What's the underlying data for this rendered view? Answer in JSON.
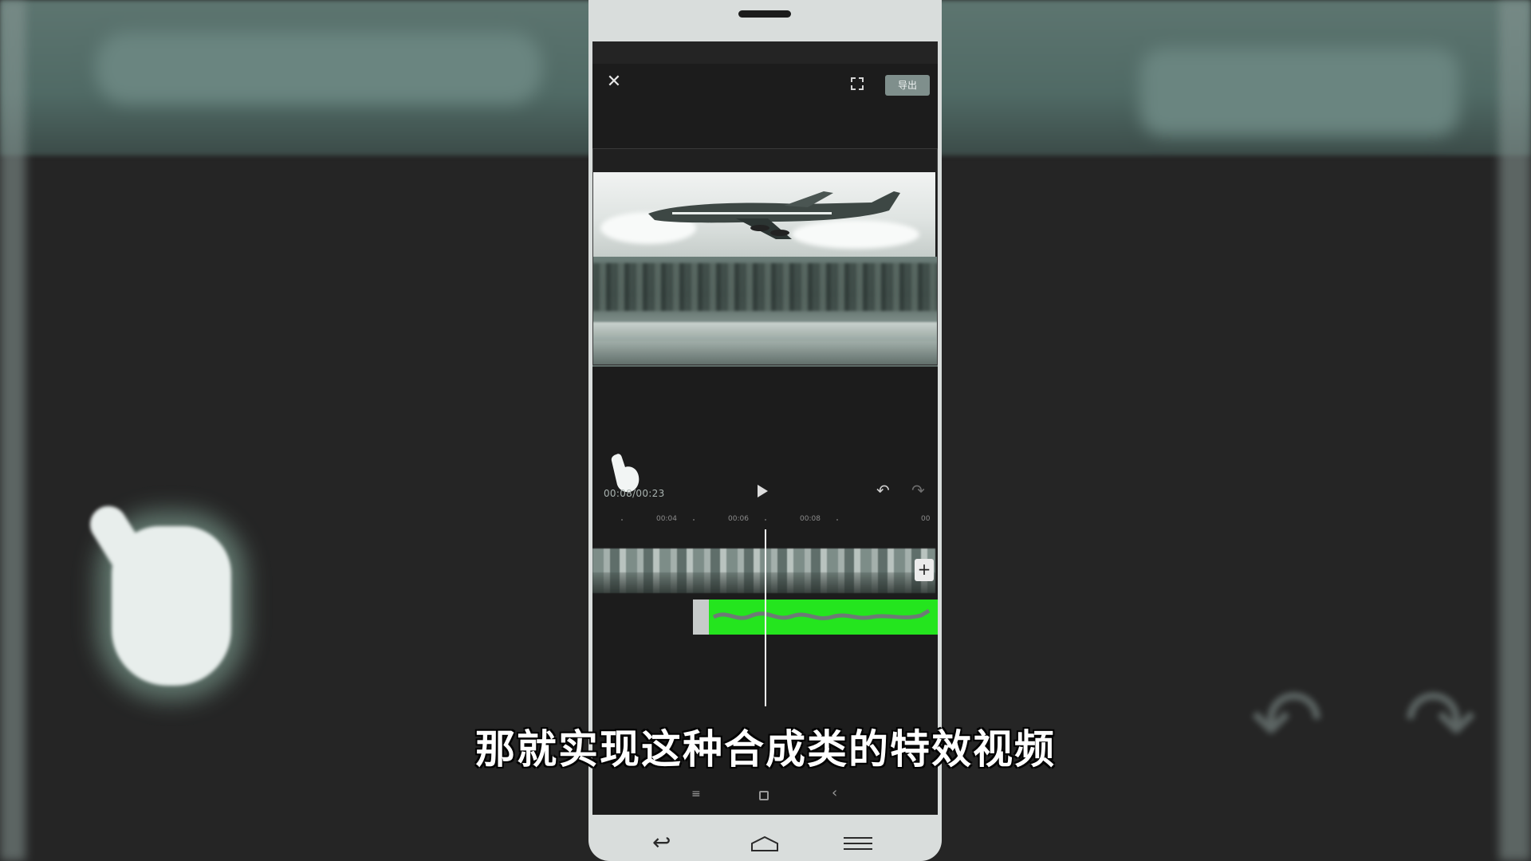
{
  "editor": {
    "export_label": "导出",
    "timecode": "00:08/00:23",
    "timeline_ticks": [
      "00:04",
      "00:06",
      "00:08",
      "00"
    ]
  },
  "subtitle": "那就实现这种合成类的特效视频",
  "colors": {
    "overlay_track": "#24e51e",
    "screen_bg": "#1c1c1c",
    "phone_frame": "#d9dddc",
    "background_teal": "#5d7570"
  },
  "icons": {
    "close": "close-icon",
    "fullscreen": "fullscreen-icon",
    "play": "play-icon",
    "undo": "undo-icon",
    "redo": "redo-icon",
    "add": "plus-icon"
  }
}
